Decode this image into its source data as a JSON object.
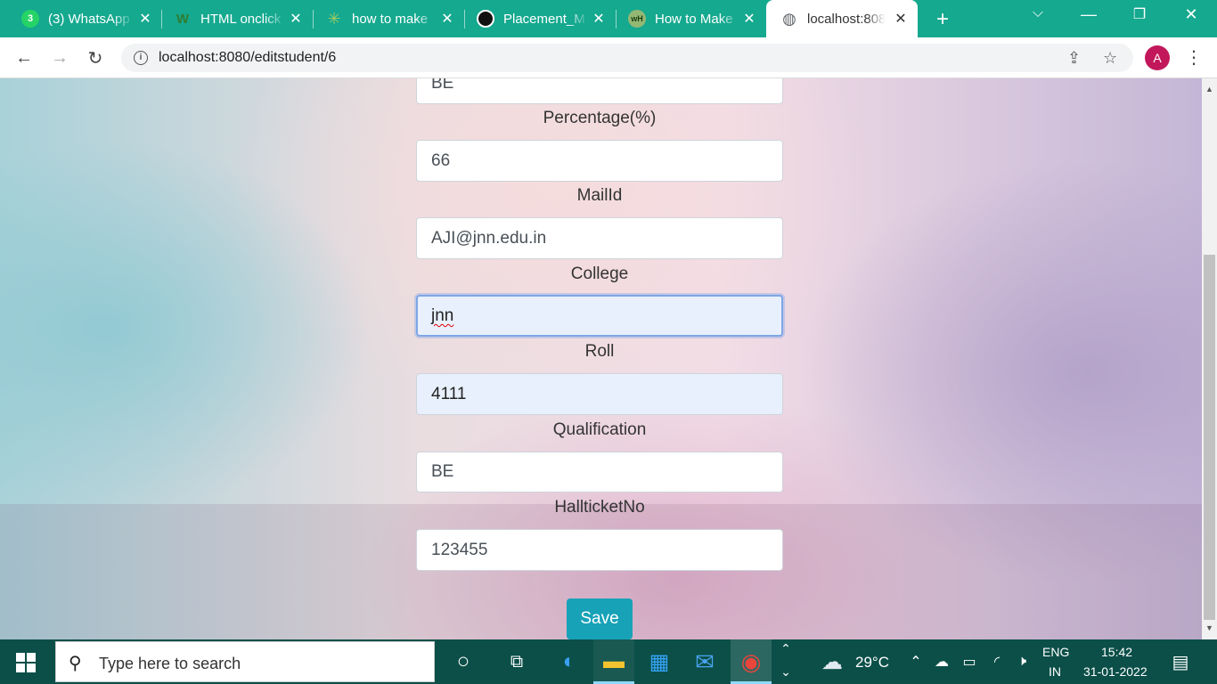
{
  "tabs": [
    {
      "title": "(3) WhatsApp",
      "icon": "whatsapp-icon",
      "badge": "3",
      "color": "#25d366"
    },
    {
      "title": "HTML onclick",
      "icon": "w3schools-icon",
      "badge": "W",
      "color": "#2e7d32"
    },
    {
      "title": "how to make",
      "icon": "pinwheel-icon",
      "badge": "✳",
      "color": "#9ccc65"
    },
    {
      "title": "Placement_M",
      "icon": "github-icon",
      "badge": "●",
      "color": "#111111"
    },
    {
      "title": "How to Make",
      "icon": "wikihow-icon",
      "badge": "wH",
      "color": "#93b874"
    },
    {
      "title": "localhost:808",
      "icon": "globe-icon",
      "badge": "◍",
      "color": "#5f6368"
    }
  ],
  "tab_close_glyph": "✕",
  "new_tab_glyph": "+",
  "window_controls": {
    "menu": "⌵",
    "minimize": "—",
    "restore": "❐",
    "close": "✕"
  },
  "toolbar": {
    "back": "←",
    "forward": "→",
    "reload": "↻",
    "url": "localhost:8080/editstudent/6",
    "info_glyph": "i",
    "share_glyph": "⇪",
    "star_glyph": "☆",
    "profile_initial": "A",
    "menu_glyph": "⋮"
  },
  "form": {
    "qualification_top_value": "BE",
    "fields": [
      {
        "label": "Percentage(%)",
        "value": "66"
      },
      {
        "label": "MailId",
        "value": "AJI@jnn.edu.in"
      },
      {
        "label": "College",
        "value": "jnn"
      },
      {
        "label": "Roll",
        "value": "4111"
      },
      {
        "label": "Qualification",
        "value": "BE"
      },
      {
        "label": "HallticketNo",
        "value": "123455"
      }
    ],
    "save_label": "Save"
  },
  "scrollbar": {
    "up": "▲",
    "down": "▼"
  },
  "taskbar": {
    "search_placeholder": "Type here to search",
    "search_glyph": "⚲",
    "cortana_glyph": "○",
    "taskview_glyph": "⧉",
    "apps": [
      {
        "name": "edge-icon",
        "glyph": "◐",
        "color": "#3aa0f0"
      },
      {
        "name": "file-explorer-icon",
        "glyph": "▬",
        "color": "#f4c430"
      },
      {
        "name": "store-icon",
        "glyph": "▦",
        "color": "#36a3f7"
      },
      {
        "name": "mail-icon",
        "glyph": "✉",
        "color": "#4aa3f0"
      },
      {
        "name": "chrome-icon",
        "glyph": "◉",
        "color": "#e8453c"
      }
    ],
    "overflow_up": "⌃",
    "overflow_down": "⌄",
    "weather_glyph": "☁",
    "temperature": "29°C",
    "tray_chevron": "⌃",
    "tray_icons": [
      "☁",
      "▭",
      "◜",
      "🕨"
    ],
    "lang_top": "ENG",
    "lang_bottom": "IN",
    "time": "15:42",
    "date": "31-01-2022",
    "notification_glyph": "▤"
  }
}
